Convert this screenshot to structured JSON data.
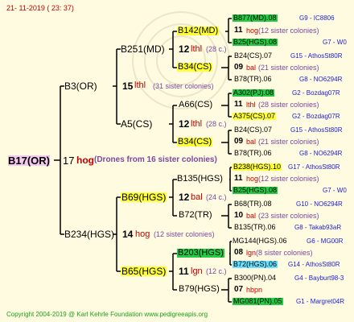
{
  "header": {
    "date": "21-  11-2019  (  23:  37)"
  },
  "footer": {
    "copyright": "Copyright 2004-2019 @ Karl Kehrle Foundation   www.pedigreeapis.org"
  },
  "colors": {
    "line": "#000000",
    "bg": "#fffbe0",
    "yellow": "#ffff33",
    "green": "#22cc44",
    "cyan": "#66e0ff",
    "pink": "#f5c8f0",
    "purple": "#7a48a0",
    "red": "#c00000",
    "blue": "#1c1cd0"
  },
  "root": {
    "id": "B17(OR)",
    "num": "17",
    "mark": "hog",
    "note": "(Drones from 16 sister colonies)"
  },
  "gen1": [
    {
      "id": "B3(OR)",
      "num": "15",
      "mark": "lthl",
      "note": "(31 sister colonies)"
    },
    {
      "id": "B234(HGS)",
      "num": "14",
      "mark": "hog",
      "note": "(12 sister colonies)"
    }
  ],
  "gen2": [
    {
      "id": "B251(MD)",
      "num": "12",
      "mark": "lthl",
      "note": "(28 c.)"
    },
    {
      "id": "A5(CS)",
      "num": "12",
      "mark": "lthl",
      "note": "(28 c.)"
    },
    {
      "id": "B69(HGS)",
      "num": "12",
      "mark": "bal",
      "note": "(24 c.)"
    },
    {
      "id": "B65(HGS)",
      "num": "11",
      "mark": "lgn",
      "note": "(12 c.)"
    }
  ],
  "gen3": [
    {
      "id": "B142(MD)"
    },
    {
      "id": "B34(CS)"
    },
    {
      "id": "A66(CS)"
    },
    {
      "id": "B34(CS)"
    },
    {
      "id": "B135(HGS)"
    },
    {
      "id": "B72(TR)"
    },
    {
      "id": "B203(HGS)"
    },
    {
      "id": "B79(HGS)"
    }
  ],
  "gen4": [
    {
      "a": "B877(MD).08",
      "b": "G9 - IC8806"
    },
    {
      "num": "11",
      "mark": "hog",
      "note": "(12 sister colonies)"
    },
    {
      "a": "B25(HGS).08",
      "b": "G7 - W0"
    },
    {
      "a": "B24(CS).07",
      "b": "G15 - AthosSt80R"
    },
    {
      "num": "09",
      "mark": "bal",
      "note": "(21 sister colonies)"
    },
    {
      "a": "B78(TR).06",
      "b": "G8 - NO6294R"
    },
    {
      "a": "A302(PJ).08",
      "b": "G2 - Bozdag07R"
    },
    {
      "num": "11",
      "mark": "lthl",
      "note": "(28 sister colonies)"
    },
    {
      "a": "A375(CS).07",
      "b": "G2 - Bozdag07R"
    },
    {
      "a": "B24(CS).07",
      "b": "G15 - AthosSt80R"
    },
    {
      "num": "09",
      "mark": "bal",
      "note": "(21 sister colonies)"
    },
    {
      "a": "B78(TR).06",
      "b": "G8 - NO6294R"
    },
    {
      "a": "B238(HGS).10",
      "b": "G17 - AthosSt80R"
    },
    {
      "num": "11",
      "mark": "hog",
      "note": "(12 sister colonies)"
    },
    {
      "a": "B25(HGS).08",
      "b": "G7 - W0"
    },
    {
      "a": "B68(TR).08",
      "b": "G10 - NO6294R"
    },
    {
      "num": "10",
      "mark": "bal",
      "note": "(23 sister colonies)"
    },
    {
      "a": "B135(TR).06",
      "b": "G8 - Takab93aR"
    },
    {
      "a": "MG144(HGS).06",
      "b": "G6 - MG00R"
    },
    {
      "num": "08",
      "mark": "lgn",
      "note": "(8 sister colonies)"
    },
    {
      "a": "B72(HGS).06",
      "b": "G14 - AthosSt80R"
    },
    {
      "a": "B300(PN).04",
      "b": "G4 - Bayburt98-3"
    },
    {
      "num": "07",
      "mark": "hbpn",
      "note": ""
    },
    {
      "a": "MG081(PN).05",
      "b": "G1 - Margret04R"
    }
  ]
}
